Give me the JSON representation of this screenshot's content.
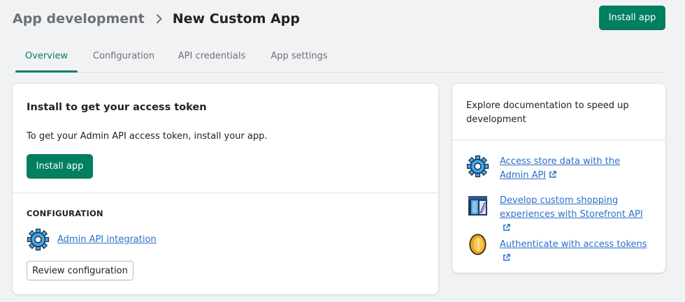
{
  "header": {
    "breadcrumb_parent": "App development",
    "page_title": "New Custom App",
    "install_button": "Install app"
  },
  "tabs": [
    {
      "label": "Overview",
      "active": true
    },
    {
      "label": "Configuration",
      "active": false
    },
    {
      "label": "API credentials",
      "active": false
    },
    {
      "label": "App settings",
      "active": false
    }
  ],
  "main_card": {
    "title": "Install to get your access token",
    "description": "To get your Admin API access token, install your app.",
    "install_button": "Install app",
    "configuration_heading": "CONFIGURATION",
    "integration_link": "Admin API integration",
    "review_button": "Review configuration"
  },
  "side_card": {
    "title": "Explore documentation to speed up development",
    "links": [
      {
        "label": "Access store data with the Admin API",
        "icon": "gear-icon"
      },
      {
        "label": "Develop custom shopping experiences with Storefront API",
        "icon": "storefront-icon"
      },
      {
        "label": "Authenticate with access tokens",
        "icon": "coin-icon"
      }
    ]
  },
  "colors": {
    "primary": "#008060",
    "link": "#2c6ecb",
    "background": "#f1f2f4"
  }
}
